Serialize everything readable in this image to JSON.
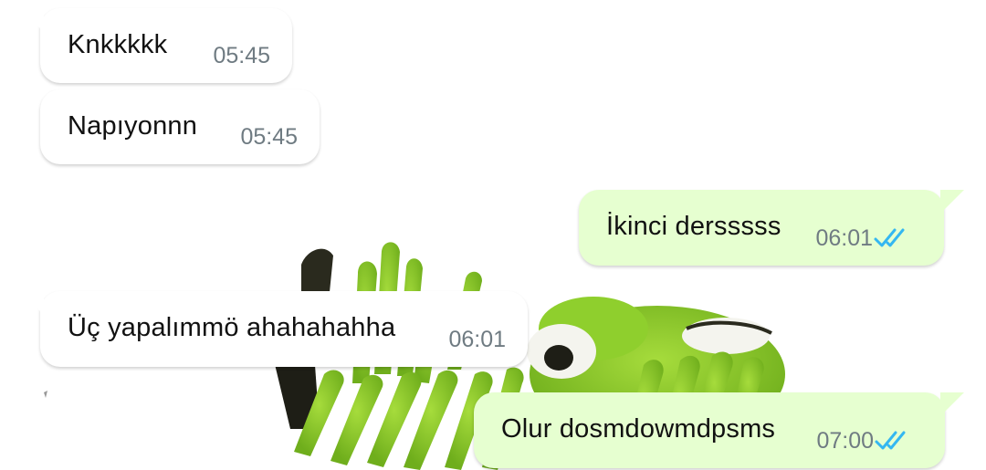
{
  "chat": {
    "messages": [
      {
        "direction": "incoming",
        "text": "Knkkkkk",
        "time": "05:45"
      },
      {
        "direction": "incoming",
        "text": "Napıyonnn",
        "time": "05:45"
      },
      {
        "direction": "outgoing",
        "text": "İkinci dersssss",
        "time": "06:01",
        "status": "read-double-check-icon"
      },
      {
        "direction": "incoming",
        "text": "Üç yapalımmö ahahahahha",
        "time": "06:01"
      },
      {
        "direction": "outgoing",
        "text": "Olur dosmdowmdpsms",
        "time": "07:00",
        "status": "read-double-check-icon"
      }
    ],
    "wallpaper": "kermit-meme-wallpaper",
    "colors": {
      "incoming_bubble": "#ffffff",
      "outgoing_bubble": "#e6ffd0",
      "read_tick": "#34b7f1",
      "timestamp": "#6f7b82",
      "kermit_green": "#8ccb2a"
    }
  }
}
